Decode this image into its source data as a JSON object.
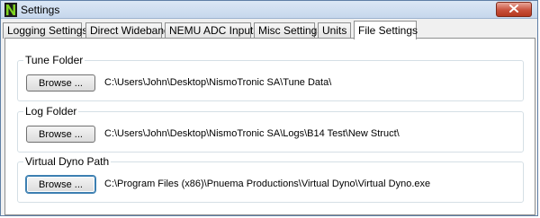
{
  "window": {
    "title": "Settings",
    "app_icon": "nismotronic-n-icon",
    "close_icon": "close-icon"
  },
  "tabs": [
    {
      "label": "Logging Settings",
      "active": false
    },
    {
      "label": "Direct Wideband",
      "active": false
    },
    {
      "label": "NEMU ADC Inputs",
      "active": false
    },
    {
      "label": "Misc Settings",
      "active": false
    },
    {
      "label": "Units",
      "active": false
    },
    {
      "label": "File Settings",
      "active": true
    }
  ],
  "groups": [
    {
      "label": "Tune Folder",
      "button": "Browse ...",
      "path": "C:\\Users\\John\\Desktop\\NismoTronic SA\\Tune Data\\"
    },
    {
      "label": "Log Folder",
      "button": "Browse ...",
      "path": "C:\\Users\\John\\Desktop\\NismoTronic SA\\Logs\\B14 Test\\New Struct\\"
    },
    {
      "label": "Virtual Dyno Path",
      "button": "Browse ...",
      "path": "C:\\Program Files (x86)\\Pnuema Productions\\Virtual Dyno\\Virtual Dyno.exe"
    }
  ]
}
